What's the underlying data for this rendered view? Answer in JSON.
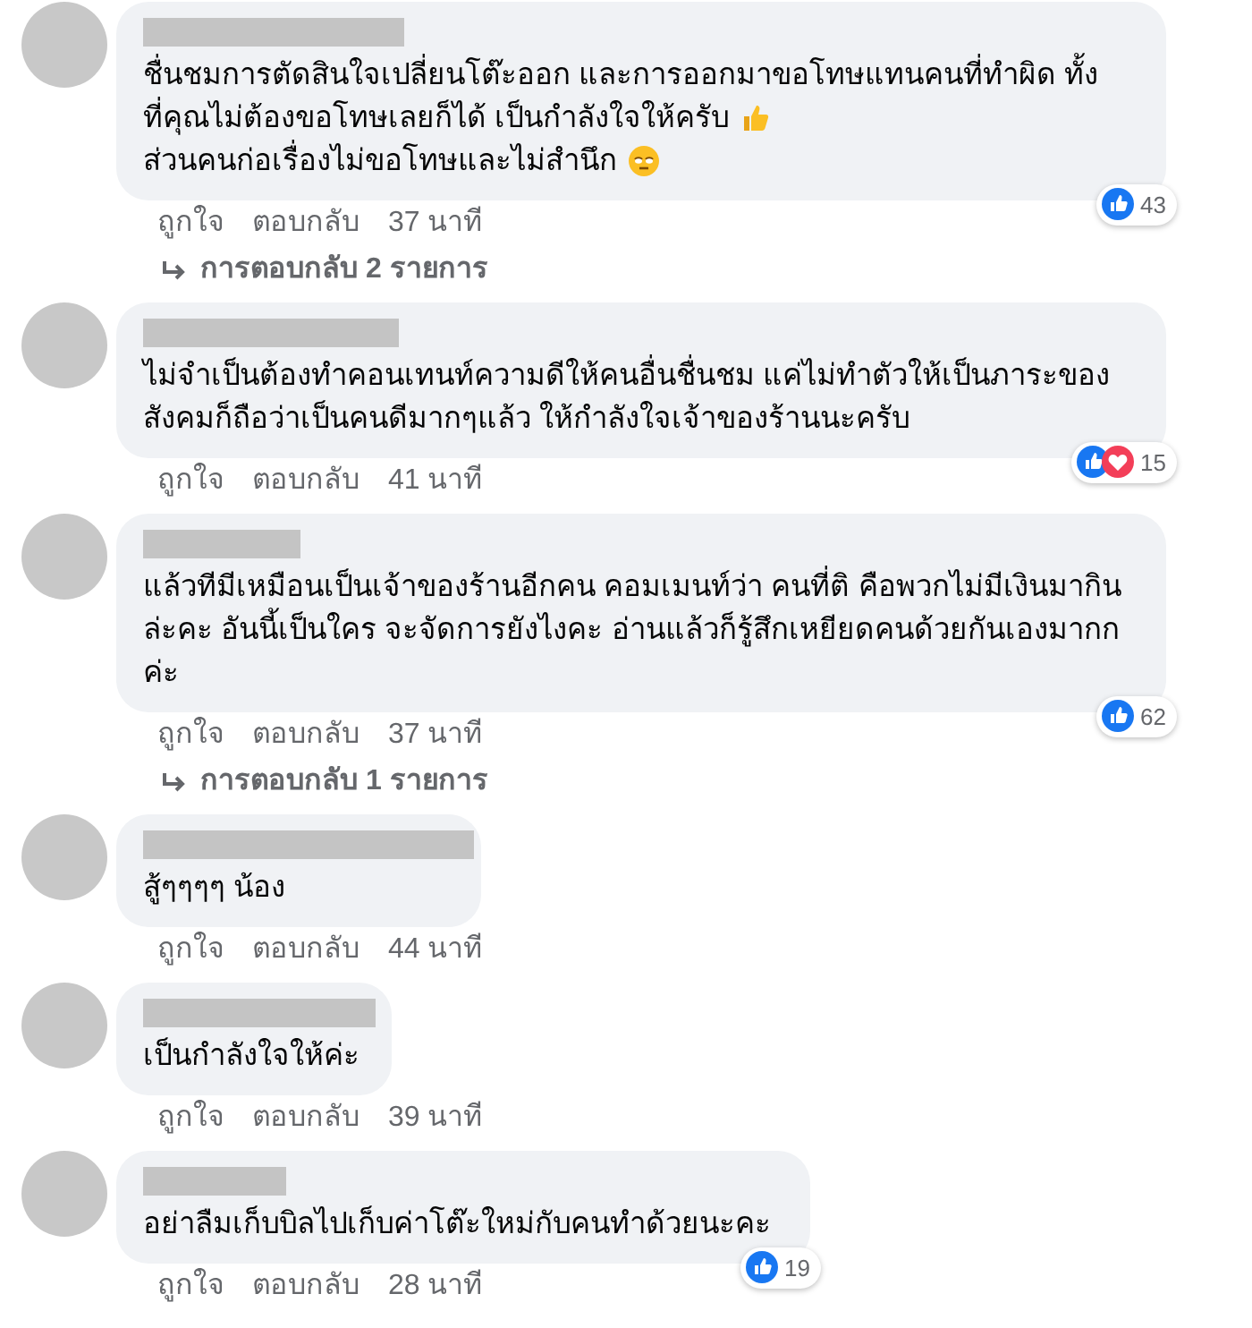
{
  "comments": [
    {
      "lines": [
        {
          "kind": "plain",
          "text": "ชื่นชมการตัดสินใจเปลี่ยนโต๊ะออก และการออกมาขอโทษแทนคนที่ทำผิด ทั้ง"
        },
        {
          "kind": "thumbsup",
          "text": "ที่คุณไม่ต้องขอโทษเลยก็ได้ เป็นกำลังใจให้ครับ"
        },
        {
          "kind": "face",
          "text": "ส่วนคนก่อเรื่องไม่ขอโทษและไม่สำนึก"
        }
      ],
      "reactions": {
        "like": true,
        "love": false,
        "count": "43"
      },
      "actions": [
        "ถูกใจ",
        "ตอบกลับ"
      ],
      "time": "37 นาที",
      "replies": "การตอบกลับ 2 รายการ"
    },
    {
      "lines": [
        {
          "kind": "plain",
          "text": "ไม่จำเป็นต้องทำคอนเทนท์ความดีให้คนอื่นชื่นชม แค่ไม่ทำตัวให้เป็นภาระของ"
        },
        {
          "kind": "plain",
          "text": "สังคมก็ถือว่าเป็นคนดีมากๆแล้ว ให้กำลังใจเจ้าของร้านนะครับ"
        }
      ],
      "reactions": {
        "like": true,
        "love": true,
        "count": "15"
      },
      "actions": [
        "ถูกใจ",
        "ตอบกลับ"
      ],
      "time": "41 นาที"
    },
    {
      "lines": [
        {
          "kind": "plain",
          "text": "แล้วทีมีเหมือนเป็นเจ้าของร้านอีกคน คอมเมนท์ว่า คนที่ติ คือพวกไม่มีเงินมากิน"
        },
        {
          "kind": "plain",
          "text": "ล่ะคะ อันนี้เป็นใคร จะจัดการยังไงคะ อ่านแล้วก็รู้สึกเหยียดคนด้วยกันเองมากก"
        },
        {
          "kind": "plain",
          "text": "ค่ะ"
        }
      ],
      "reactions": {
        "like": true,
        "love": false,
        "count": "62"
      },
      "actions": [
        "ถูกใจ",
        "ตอบกลับ"
      ],
      "time": "37 นาที",
      "replies": "การตอบกลับ 1 รายการ"
    },
    {
      "lines": [
        {
          "kind": "plain",
          "text": "สู้ๆๆๆๆ น้อง"
        }
      ],
      "actions": [
        "ถูกใจ",
        "ตอบกลับ"
      ],
      "time": "44 นาที"
    },
    {
      "lines": [
        {
          "kind": "plain",
          "text": "เป็นกำลังใจให้ค่ะ"
        }
      ],
      "actions": [
        "ถูกใจ",
        "ตอบกลับ"
      ],
      "time": "39 นาที"
    },
    {
      "lines": [
        {
          "kind": "plain",
          "text": "อย่าลืมเก็บบิลไปเก็บค่าโต๊ะใหม่กับคนทำด้วยนะคะ"
        }
      ],
      "reactions": {
        "like": true,
        "love": false,
        "count": "19"
      },
      "actions": [
        "ถูกใจ",
        "ตอบกลับ"
      ],
      "time": "28 นาที"
    }
  ]
}
